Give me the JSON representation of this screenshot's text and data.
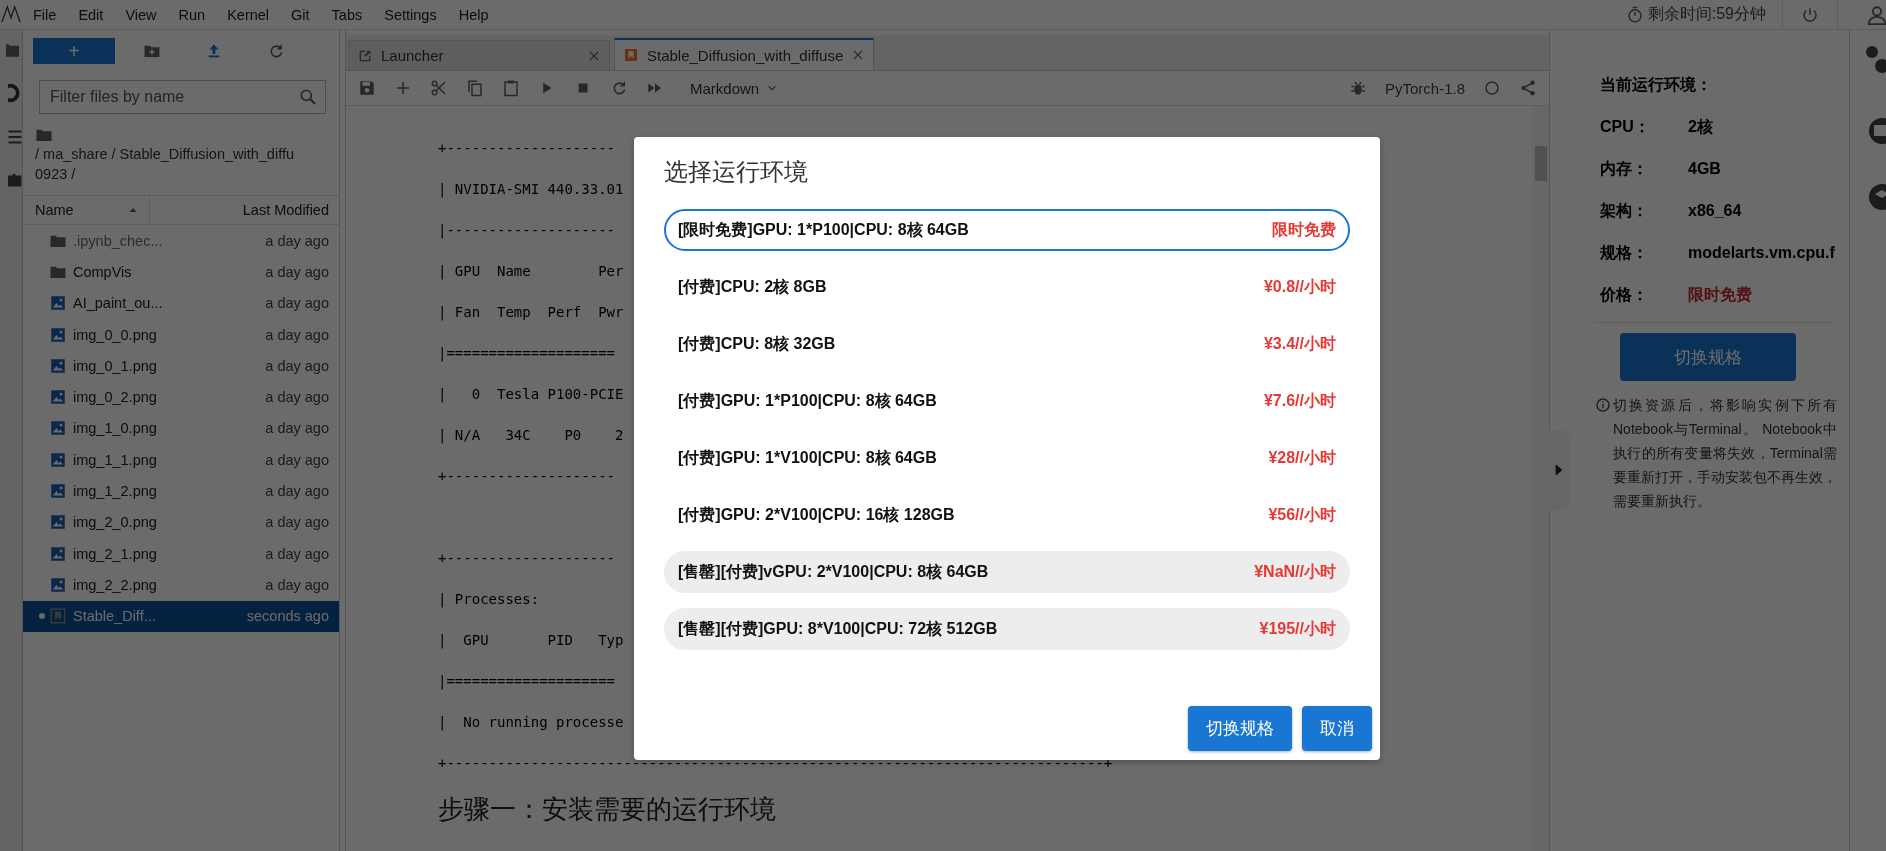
{
  "menu": [
    "File",
    "Edit",
    "View",
    "Run",
    "Kernel",
    "Git",
    "Tabs",
    "Settings",
    "Help"
  ],
  "top_right": {
    "timer": "剩余时间:59分钟"
  },
  "file_browser": {
    "new_button": "+",
    "filter": {
      "placeholder": "Filter files by name"
    },
    "path_lines": [
      "/ ma_share / Stable_Diffusion_with_diffu",
      "0923 /"
    ],
    "columns": [
      "Name",
      "Last Modified"
    ],
    "files": [
      {
        "name": ".ipynb_chec...",
        "modified": "a day ago",
        "kind": "folder",
        "hidden": true,
        "selected": false,
        "running": false
      },
      {
        "name": "CompVis",
        "modified": "a day ago",
        "kind": "folder",
        "hidden": false,
        "selected": false,
        "running": false
      },
      {
        "name": "AI_paint_ou...",
        "modified": "a day ago",
        "kind": "image",
        "hidden": false,
        "selected": false,
        "running": false
      },
      {
        "name": "img_0_0.png",
        "modified": "a day ago",
        "kind": "image",
        "hidden": false,
        "selected": false,
        "running": false
      },
      {
        "name": "img_0_1.png",
        "modified": "a day ago",
        "kind": "image",
        "hidden": false,
        "selected": false,
        "running": false
      },
      {
        "name": "img_0_2.png",
        "modified": "a day ago",
        "kind": "image",
        "hidden": false,
        "selected": false,
        "running": false
      },
      {
        "name": "img_1_0.png",
        "modified": "a day ago",
        "kind": "image",
        "hidden": false,
        "selected": false,
        "running": false
      },
      {
        "name": "img_1_1.png",
        "modified": "a day ago",
        "kind": "image",
        "hidden": false,
        "selected": false,
        "running": false
      },
      {
        "name": "img_1_2.png",
        "modified": "a day ago",
        "kind": "image",
        "hidden": false,
        "selected": false,
        "running": false
      },
      {
        "name": "img_2_0.png",
        "modified": "a day ago",
        "kind": "image",
        "hidden": false,
        "selected": false,
        "running": false
      },
      {
        "name": "img_2_1.png",
        "modified": "a day ago",
        "kind": "image",
        "hidden": false,
        "selected": false,
        "running": false
      },
      {
        "name": "img_2_2.png",
        "modified": "a day ago",
        "kind": "image",
        "hidden": false,
        "selected": false,
        "running": false
      },
      {
        "name": "Stable_Diff...",
        "modified": "seconds ago",
        "kind": "notebook",
        "hidden": false,
        "selected": true,
        "running": true
      }
    ]
  },
  "tabs": [
    {
      "label": "Launcher",
      "kind": "launcher",
      "selected": false
    },
    {
      "label": "Stable_Diffusion_with_diffuse",
      "kind": "notebook",
      "selected": true
    }
  ],
  "notebook_toolbar": {
    "cell_type": "Markdown",
    "kernel": "PyTorch-1.8"
  },
  "output_blocks": [
    [
      "+--------------------",
      "| NVIDIA-SMI 440.33.01",
      "|--------------------",
      "| GPU  Name        Per",
      "| Fan  Temp  Perf  Pwr",
      "|====================",
      "|   0  Tesla P100-PCIE",
      "| N/A   34C    P0    2",
      "+--------------------"
    ],
    [
      "+--------------------",
      "| Processes:",
      "|  GPU       PID   Typ",
      "|====================",
      "|  No running processe",
      "+------------------------------------------------------------------------------+"
    ]
  ],
  "heading": "步骤一：安装需要的运行环境",
  "env_panel": {
    "title": "当前运行环境：",
    "rows": [
      {
        "label": "CPU：",
        "value": "2核",
        "kind": "spec"
      },
      {
        "label": "内存：",
        "value": "4GB",
        "kind": "spec"
      },
      {
        "label": "架构：",
        "value": "x86_64",
        "kind": "spec"
      },
      {
        "label": "规格：",
        "value": "modelarts.vm.cpu.f",
        "kind": "spec"
      },
      {
        "label": "价格：",
        "value": "限时免费",
        "kind": "price"
      }
    ],
    "button": "切换规格",
    "notice": "切换资源后，将影响实例下所有Notebook与Terminal。 Notebook中执行的所有变量将失效，Terminal需要重新打开，手动安装包不再生效，需要重新执行。"
  },
  "dialog": {
    "title": "选择运行环境",
    "options": [
      {
        "label": "[限时免费]GPU: 1*P100|CPU: 8核 64GB",
        "price": "限时免费",
        "selected": true,
        "disabled": false
      },
      {
        "label": "[付费]CPU: 2核 8GB",
        "price": "¥0.8//小时",
        "selected": false,
        "disabled": false
      },
      {
        "label": "[付费]CPU: 8核 32GB",
        "price": "¥3.4//小时",
        "selected": false,
        "disabled": false
      },
      {
        "label": "[付费]GPU: 1*P100|CPU: 8核 64GB",
        "price": "¥7.6//小时",
        "selected": false,
        "disabled": false
      },
      {
        "label": "[付费]GPU: 1*V100|CPU: 8核 64GB",
        "price": "¥28//小时",
        "selected": false,
        "disabled": false
      },
      {
        "label": "[付费]GPU: 2*V100|CPU: 16核 128GB",
        "price": "¥56//小时",
        "selected": false,
        "disabled": false
      },
      {
        "label": "[售罄][付费]vGPU: 2*V100|CPU: 8核 64GB",
        "price": "¥NaN//小时",
        "selected": false,
        "disabled": true
      },
      {
        "label": "[售罄][付费]GPU: 8*V100|CPU: 72核 512GB",
        "price": "¥195//小时",
        "selected": false,
        "disabled": true
      }
    ],
    "buttons": [
      {
        "label": "切换规格",
        "kind": "primary"
      },
      {
        "label": "取消",
        "kind": "primary"
      }
    ]
  }
}
